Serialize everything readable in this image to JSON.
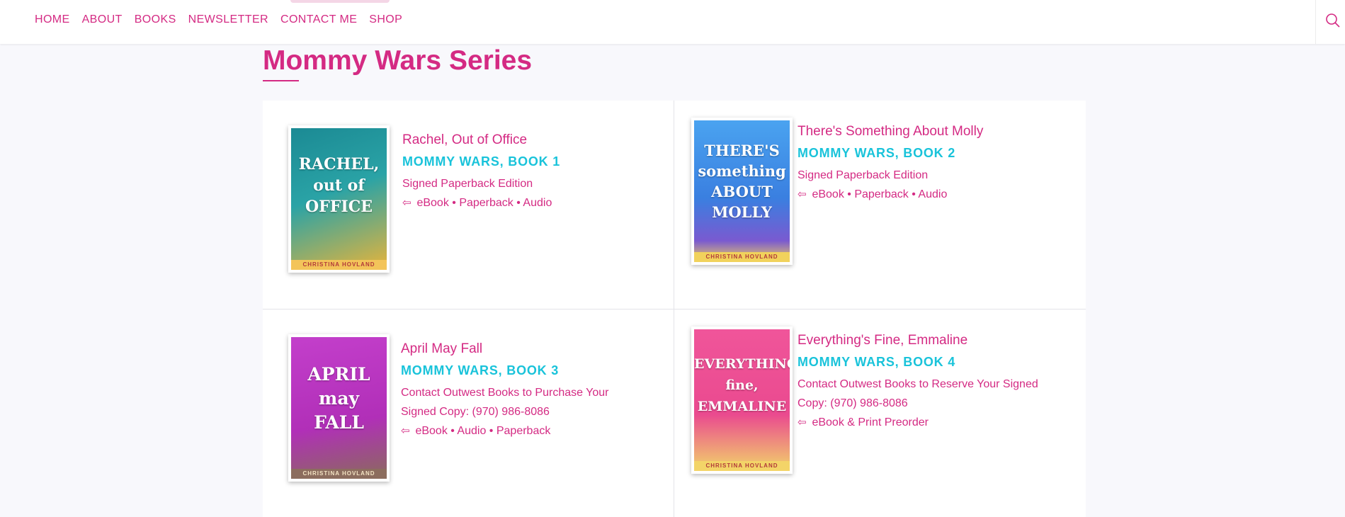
{
  "nav": {
    "items": [
      "HOME",
      "ABOUT",
      "BOOKS",
      "NEWSLETTER",
      "CONTACT ME",
      "SHOP"
    ],
    "search_icon": "search-icon"
  },
  "page": {
    "title": "Mommy Wars Series"
  },
  "books": [
    {
      "title": "Rachel, Out of Office",
      "series": "MOMMY WARS, BOOK 1",
      "lines": [
        "Signed Paperback Edition"
      ],
      "links": "eBook • Paperback • Audio",
      "cover": {
        "text": "RACHEL, out of OFFICE",
        "author": "CHRISTINA HOVLAND",
        "color": "#1f8e95"
      }
    },
    {
      "title": "There's Something About Molly",
      "series": "MOMMY WARS, BOOK 2",
      "lines": [
        "Signed Paperback Edition"
      ],
      "links": "eBook • Paperback • Audio",
      "cover": {
        "text": "THERE'S something ABOUT MOLLY",
        "author": "CHRISTINA HOVLAND",
        "color": "#3b8fe6"
      }
    },
    {
      "title": "April May Fall",
      "series": "MOMMY WARS, BOOK 3",
      "lines": [
        "Contact Outwest Books to Purchase Your",
        "Signed Copy: (970) 986-8086"
      ],
      "links": "eBook • Audio • Paperback",
      "cover": {
        "text": "APRIL may FALL",
        "author": "CHRISTINA HOVLAND",
        "color": "#c13bc8"
      }
    },
    {
      "title": "Everything's Fine, Emmaline",
      "series": "MOMMY WARS, BOOK 4",
      "lines": [
        "Contact Outwest Books to Reserve Your Signed",
        "Copy: (970) 986-8086"
      ],
      "links": "eBook & Print Preorder",
      "cover": {
        "text": "EVERYTHING'S fine, EMMALINE",
        "author": "CHRISTINA HOVLAND",
        "color": "#ef4f95"
      }
    }
  ],
  "colors": {
    "accent": "#d42a83",
    "series": "#19c3da",
    "background": "#f8f8fc"
  }
}
